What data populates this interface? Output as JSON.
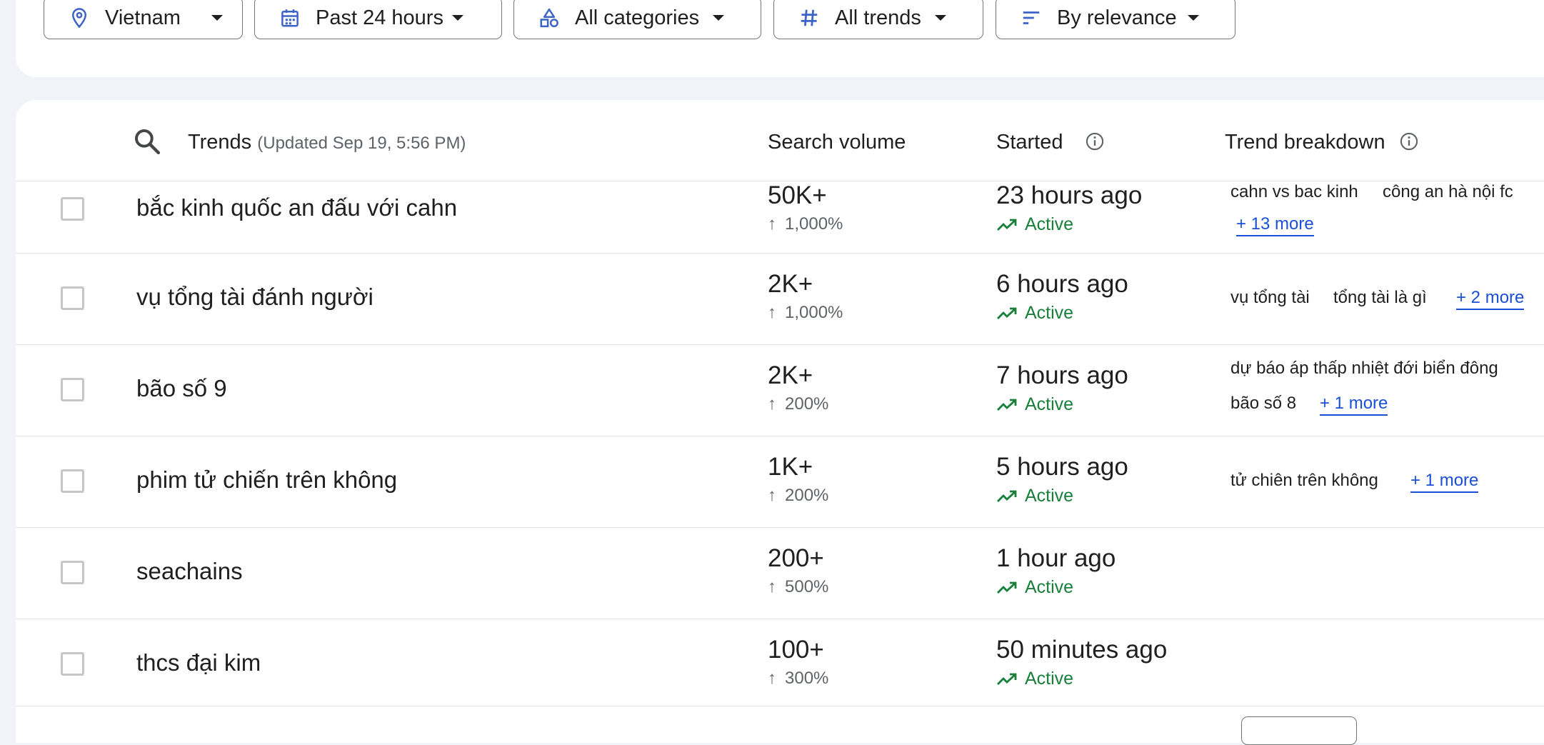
{
  "filters": [
    {
      "label": "Vietnam",
      "icon": "location-pin-icon"
    },
    {
      "label": "Past 24 hours",
      "icon": "calendar-icon"
    },
    {
      "label": "All categories",
      "icon": "category-shapes-icon"
    },
    {
      "label": "All trends",
      "icon": "hashtag-icon"
    },
    {
      "label": "By relevance",
      "icon": "sort-icon"
    }
  ],
  "table": {
    "header": {
      "trends": "Trends",
      "updated": "(Updated Sep 19, 5:56 PM)",
      "search_volume": "Search volume",
      "started": "Started",
      "trend_breakdown": "Trend breakdown"
    },
    "rows": [
      {
        "term": "bắc kinh quốc an đấu với cahn",
        "volume": "50K+",
        "change": "1,000%",
        "started": "23 hours ago",
        "status": "Active",
        "breakdown": [
          "cahn vs bac kinh",
          "công an hà nội fc"
        ],
        "more": "+ 13 more"
      },
      {
        "term": "vụ tổng tài đánh người",
        "volume": "2K+",
        "change": "1,000%",
        "started": "6 hours ago",
        "status": "Active",
        "breakdown": [
          "vụ tổng tài",
          "tổng tài là gì"
        ],
        "more": "+ 2 more"
      },
      {
        "term": "bão số 9",
        "volume": "2K+",
        "change": "200%",
        "started": "7 hours ago",
        "status": "Active",
        "breakdown": [
          "dự báo áp thấp nhiệt đới biển đông",
          "bão số 8"
        ],
        "more": "+ 1 more"
      },
      {
        "term": "phim tử chiến trên không",
        "volume": "1K+",
        "change": "200%",
        "started": "5 hours ago",
        "status": "Active",
        "breakdown": [
          "tử chiên trên không"
        ],
        "more": "+ 1 more"
      },
      {
        "term": "seachains",
        "volume": "200+",
        "change": "500%",
        "started": "1 hour ago",
        "status": "Active",
        "breakdown": [],
        "more": ""
      },
      {
        "term": "thcs đại kim",
        "volume": "100+",
        "change": "300%",
        "started": "50 minutes ago",
        "status": "Active",
        "breakdown": [],
        "more": ""
      }
    ]
  },
  "colors": {
    "accent": "#1a4fd6",
    "active": "#188038",
    "icon_blue": "#3c63c6",
    "secondary_text": "#5f6368"
  }
}
